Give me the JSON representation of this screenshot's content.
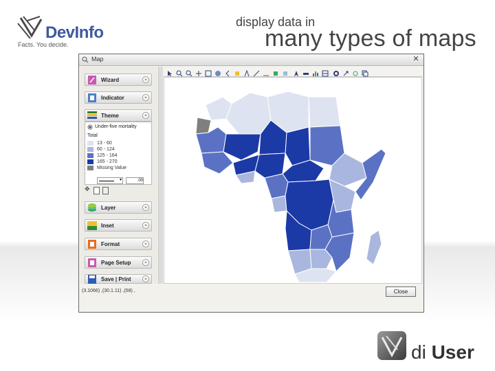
{
  "header": {
    "brand": "DevInfo",
    "tagline": "Facts. You decide.",
    "subtitle": "display data in",
    "title": "many types of maps"
  },
  "window": {
    "title": "Map",
    "left_panel": {
      "buttons": [
        {
          "label": "Wizard",
          "icon": "wizard-icon"
        },
        {
          "label": "Indicator",
          "icon": "indicator-icon"
        },
        {
          "label": "Theme",
          "icon": "theme-icon"
        }
      ],
      "lower_buttons": [
        {
          "label": "Layer",
          "icon": "layer-icon"
        },
        {
          "label": "Inset",
          "icon": "inset-icon"
        },
        {
          "label": "Format",
          "icon": "format-icon"
        },
        {
          "label": "Page Setup",
          "icon": "page-setup-icon"
        },
        {
          "label": "Save | Print",
          "icon": "save-icon"
        }
      ],
      "legend": {
        "indicator": "Under-five mortality",
        "subgroup": "Total",
        "ranges": [
          {
            "label": "13 - 60",
            "color": "#dde3f0"
          },
          {
            "label": "60 - 124",
            "color": "#a9b7de"
          },
          {
            "label": "125 - 164",
            "color": "#5b72c4"
          },
          {
            "label": "165 - 270",
            "color": "#1c3aa6"
          },
          {
            "label": "Missing Value",
            "color": "#7f7f7f"
          }
        ],
        "line_width": ".00"
      }
    },
    "status_text": "(3.1066)  ,(30.1.11)  ,(58)   ,",
    "close_label": "Close"
  },
  "footer": {
    "prefix": "di",
    "word": "User"
  },
  "colors": {
    "light": "#dde3f0",
    "mid_light": "#a9b7de",
    "mid_dark": "#5b72c4",
    "dark": "#1c3aa6",
    "missing": "#7f7f7f"
  }
}
